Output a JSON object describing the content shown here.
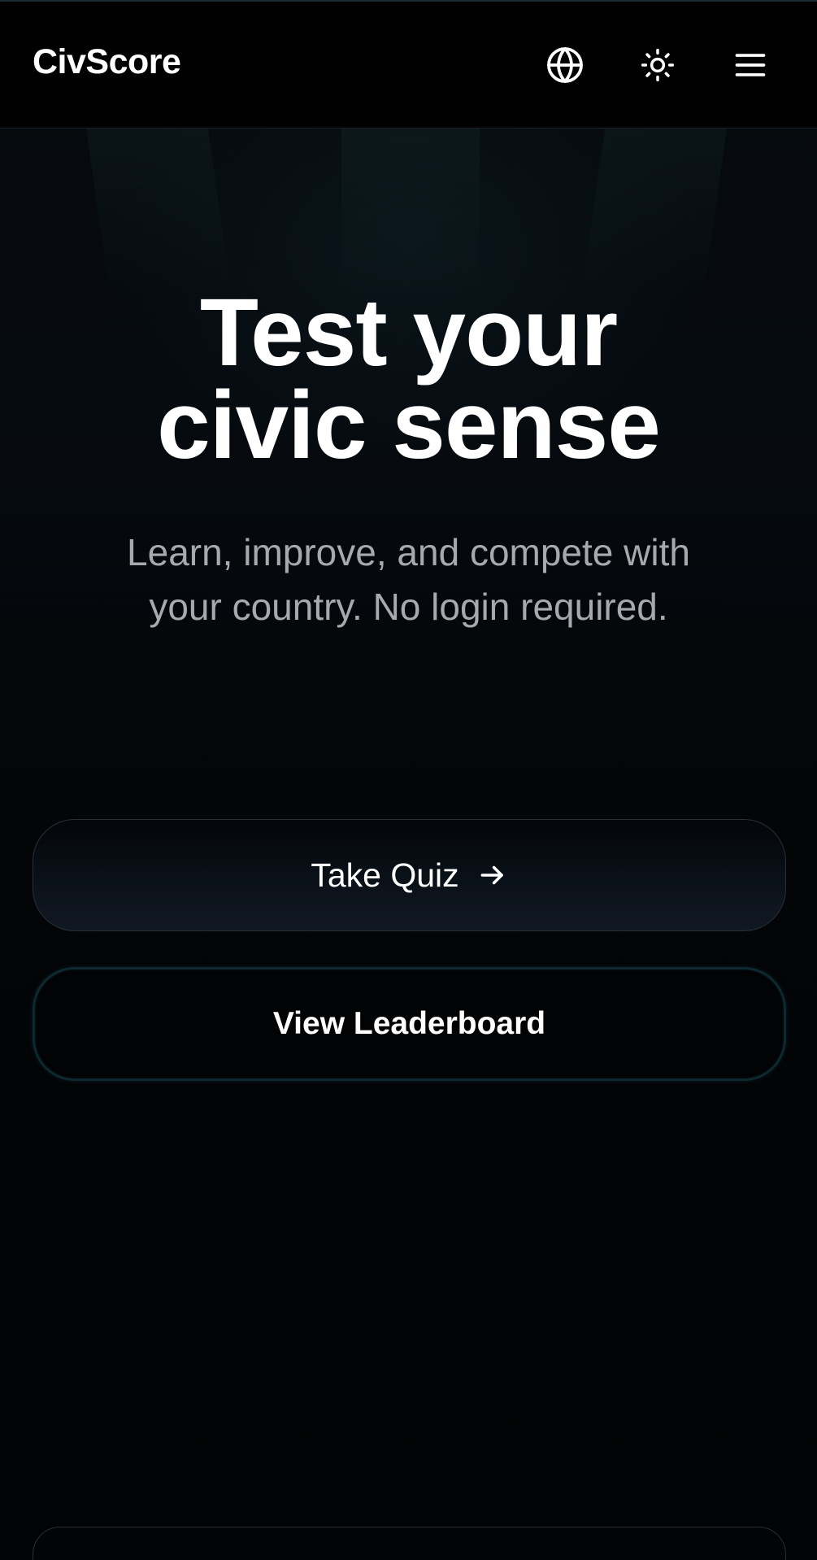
{
  "header": {
    "brand": "CivScore",
    "icons": {
      "language": "globe-icon",
      "theme": "sun-icon",
      "menu": "hamburger-menu-icon"
    }
  },
  "hero": {
    "title_line1": "Test your",
    "title_line2": "civic sense",
    "subtitle_line1": "Learn, improve, and compete with",
    "subtitle_line2": "your country. No login required."
  },
  "actions": {
    "take_quiz_label": "Take Quiz",
    "take_quiz_icon": "arrow-right-icon",
    "leaderboard_label": "View Leaderboard"
  },
  "colors": {
    "background": "#020304",
    "text_primary": "#ffffff",
    "text_secondary": "#a6a9ad",
    "leaderboard_border": "#0e2830"
  }
}
